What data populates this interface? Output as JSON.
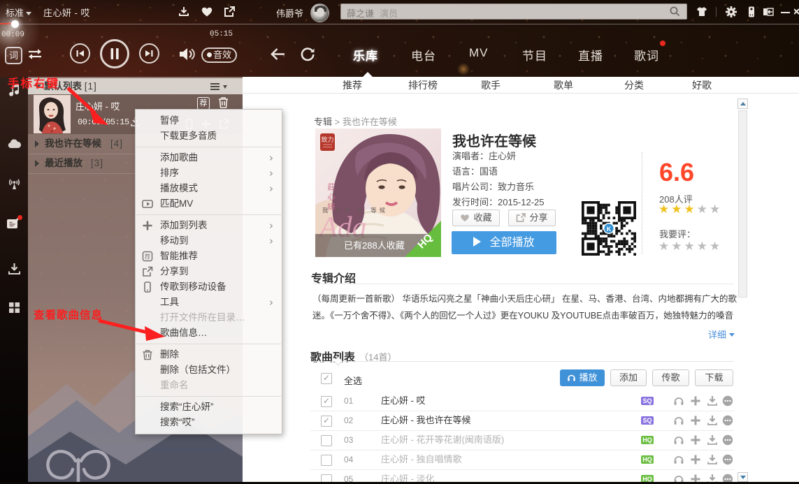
{
  "window": {
    "skin_mode": "标准",
    "song_title": "庄心妍 - 哎",
    "user_name": "伟爵爷"
  },
  "search": {
    "placeholder_main": "薛之谦",
    "placeholder_hint": "演员"
  },
  "player": {
    "elapsed": "00:09",
    "duration": "05:15",
    "lyrics_badge": "词",
    "sound_effect": "音效"
  },
  "nav": {
    "items": [
      "乐库",
      "电台",
      "MV",
      "节目",
      "直播",
      "歌词"
    ],
    "active": "乐库"
  },
  "tabs": [
    "推荐",
    "排行榜",
    "歌手",
    "歌单",
    "分类",
    "好歌"
  ],
  "sidebar": {
    "default_list_label": "默认列表",
    "default_list_count": "[1]",
    "now_playing": {
      "title": "庄心妍 - 哎",
      "time": "00:09/05:15",
      "recommend_badge": "荐"
    },
    "lists": [
      {
        "label": "我也许在等候",
        "count": "[4]"
      },
      {
        "label": "最近播放",
        "count": "[3]"
      }
    ]
  },
  "breadcrumb": {
    "root": "专辑",
    "sep": ">",
    "current": "我也许在等候"
  },
  "album": {
    "title": "我也许在等候",
    "meta": [
      {
        "label": "演唱者：",
        "value": "庄心妍"
      },
      {
        "label": "语言：",
        "value": "国语"
      },
      {
        "label": "唱片公司：",
        "value": "致力音乐"
      },
      {
        "label": "发行时间：",
        "value": "2015-12-25"
      }
    ],
    "fav_overlay": "已有288人收藏",
    "hq_ribbon": "HQ",
    "collect_label": "收藏",
    "share_label": "分享",
    "play_all_label": "全部播放",
    "cover_seal": "致力",
    "cover_artist_vertical": "莊心妍",
    "cover_caption": "我 也許 在 等候",
    "cover_word": "Ada"
  },
  "rating": {
    "score": "6.6",
    "votes": "208人评",
    "stars_filled": 3,
    "stars_total": 5,
    "my_label": "我要评：",
    "my_stars_filled": 0
  },
  "intro": {
    "heading": "专辑介绍",
    "line1": "（每周更新一首新歌） 华语乐坛闪亮之星「神曲小天后庄心研」 在星、马、香港、台湾、内地都拥有广大的歌",
    "line2": "迷。《一万个舍不得》、《两个人的回忆一个人过》更在YOUKU 及YOUTUBE点击率破百万，她独特魅力的嗓音",
    "more": "详细"
  },
  "songlist": {
    "heading": "歌曲列表",
    "count": "（14首）",
    "select_all": "全选",
    "play_label": "播放",
    "add_label": "添加",
    "send_label": "传歌",
    "download_label": "下载",
    "rows": [
      {
        "no": "01",
        "title": "庄心妍 - 哎",
        "checked": true,
        "badge": "SQ"
      },
      {
        "no": "02",
        "title": "庄心妍 - 我也许在等候",
        "checked": true,
        "badge": "SQ"
      },
      {
        "no": "03",
        "title": "庄心妍 - 花开等花谢(闽南语版)",
        "checked": false,
        "badge": "HQ"
      },
      {
        "no": "04",
        "title": "庄心妍 - 独自唱情歌",
        "checked": false,
        "badge": "HQ"
      },
      {
        "no": "05",
        "title": "庄心妍 - 淡化",
        "checked": false,
        "badge": "HQ"
      }
    ]
  },
  "context_menu": {
    "items": [
      {
        "label": "暂停"
      },
      {
        "label": "下载更多音质"
      },
      {
        "label": "添加歌曲",
        "submenu": true
      },
      {
        "label": "排序",
        "submenu": true
      },
      {
        "label": "播放模式",
        "submenu": true
      },
      {
        "label": "匹配MV",
        "icon": "mv"
      },
      {
        "label": "添加到列表",
        "icon": "plus",
        "submenu": true
      },
      {
        "label": "移动到",
        "submenu": true
      },
      {
        "label": "智能推荐",
        "icon": "recommend"
      },
      {
        "label": "分享到",
        "icon": "share"
      },
      {
        "label": "传歌到移动设备",
        "icon": "phone"
      },
      {
        "label": "工具",
        "submenu": true
      },
      {
        "label": "打开文件所在目录…",
        "disabled": true
      },
      {
        "label": "歌曲信息…"
      },
      {
        "label": "删除",
        "icon": "trash"
      },
      {
        "label": "删除（包括文件）"
      },
      {
        "label": "重命名",
        "disabled": true
      },
      {
        "label": "搜索“庄心妍”"
      },
      {
        "label": "搜索“哎”"
      }
    ]
  },
  "annotations": {
    "note1": "手标右键",
    "note2": "查看歌曲信息"
  }
}
